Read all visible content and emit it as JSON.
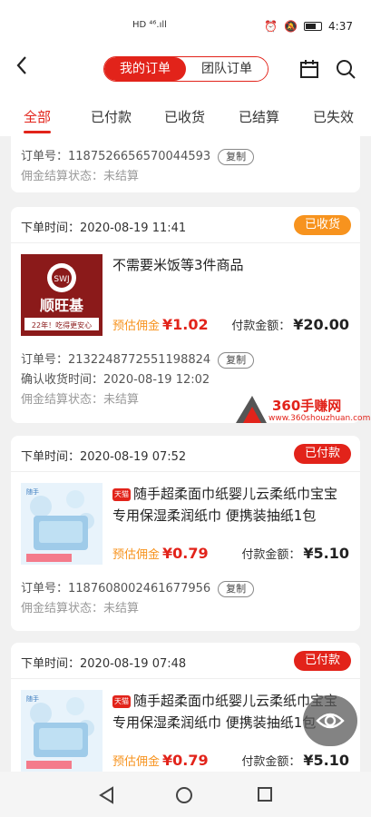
{
  "status_bar": {
    "left": "HD ⁴⁶.ıll",
    "time": "4:37"
  },
  "header": {
    "segments": [
      "我的订单",
      "团队订单"
    ],
    "back_icon": "chevron-left-icon",
    "icons": [
      "calendar-icon",
      "search-icon"
    ]
  },
  "tabs": [
    "全部",
    "已付款",
    "已收货",
    "已结算",
    "已失效"
  ],
  "partial_card": {
    "order_label": "订单号：",
    "order_no": "1187526656570044593",
    "copy": "复制",
    "settle_label": "佣金结算状态：",
    "settle_value": "未结算"
  },
  "orders": [
    {
      "time_label": "下单时间：",
      "time": "2020-08-19 11:41",
      "status": "已收货",
      "status_color": "#f7931e",
      "title": "不需要米饭等3件商品",
      "platform_badge": "",
      "brand": "顺旺基",
      "brand_slogan": "22年！吃得更安心",
      "est_label": "预估佣金",
      "est_value": "¥1.02",
      "pay_label": "付款金额：",
      "pay_value": "¥20.00",
      "order_label": "订单号：",
      "order_no": "2132248772551198824",
      "copy": "复制",
      "confirm_label": "确认收货时间：",
      "confirm_time": "2020-08-19 12:02",
      "settle_label": "佣金结算状态：",
      "settle_value": "未结算"
    },
    {
      "time_label": "下单时间：",
      "time": "2020-08-19 07:52",
      "status": "已付款",
      "status_color": "#e2231a",
      "title": "随手超柔面巾纸婴儿云柔纸巾宝宝专用保湿柔润纸巾 便携装抽纸1包",
      "platform_badge": "天猫",
      "est_label": "预估佣金",
      "est_value": "¥0.79",
      "pay_label": "付款金额：",
      "pay_value": "¥5.10",
      "order_label": "订单号：",
      "order_no": "1187608002461677956",
      "copy": "复制",
      "settle_label": "佣金结算状态：",
      "settle_value": "未结算"
    },
    {
      "time_label": "下单时间：",
      "time": "2020-08-19 07:48",
      "status": "已付款",
      "status_color": "#e2231a",
      "title": "随手超柔面巾纸婴儿云柔纸巾宝宝专用保湿柔润纸巾 便携装抽纸1包",
      "platform_badge": "天猫",
      "est_label": "预估佣金",
      "est_value": "¥0.79",
      "pay_label": "付款金额：",
      "pay_value": "¥5.10"
    }
  ],
  "watermark": {
    "text": "360手赚网",
    "url": "www.360shouzhuan.com"
  },
  "floating_button": "eye-icon",
  "colors": {
    "accent": "#e2231a",
    "orange": "#f7931e"
  }
}
